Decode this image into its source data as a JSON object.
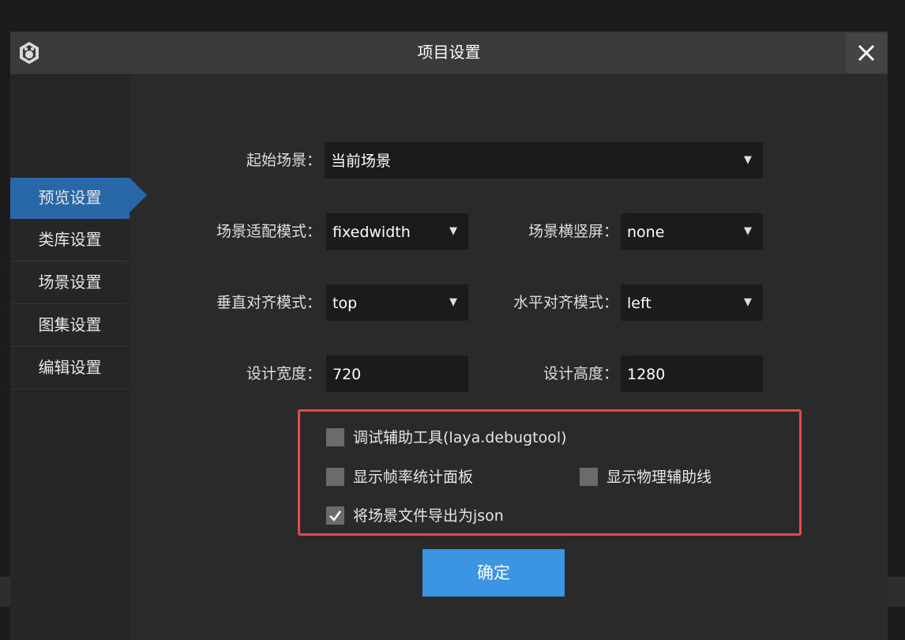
{
  "dialog": {
    "title": "项目设置",
    "close_icon": "close-icon",
    "app_icon": "laya-logo-icon"
  },
  "sidebar": {
    "items": [
      {
        "label": "预览设置",
        "active": true
      },
      {
        "label": "类库设置",
        "active": false
      },
      {
        "label": "场景设置",
        "active": false
      },
      {
        "label": "图集设置",
        "active": false
      },
      {
        "label": "编辑设置",
        "active": false
      }
    ]
  },
  "form": {
    "start_scene": {
      "label": "起始场景：",
      "value": "当前场景"
    },
    "scale_mode": {
      "label": "场景适配模式：",
      "value": "fixedwidth"
    },
    "screen_mode": {
      "label": "场景横竖屏：",
      "value": "none"
    },
    "align_v": {
      "label": "垂直对齐模式：",
      "value": "top"
    },
    "align_h": {
      "label": "水平对齐模式：",
      "value": "left"
    },
    "design_width": {
      "label": "设计宽度：",
      "value": "720"
    },
    "design_height": {
      "label": "设计高度：",
      "value": "1280"
    },
    "caret_icon": "caret-down-icon"
  },
  "options": {
    "debug_tool": {
      "label": "调试辅助工具(laya.debugtool)",
      "checked": false
    },
    "show_fps": {
      "label": "显示帧率统计面板",
      "checked": false
    },
    "show_physics": {
      "label": "显示物理辅助线",
      "checked": false
    },
    "export_json": {
      "label": "将场景文件导出为json",
      "checked": true
    }
  },
  "buttons": {
    "confirm": "确定"
  },
  "colors": {
    "accent": "#2867a8",
    "button": "#3b95e3",
    "highlight_border": "#e8484b"
  }
}
